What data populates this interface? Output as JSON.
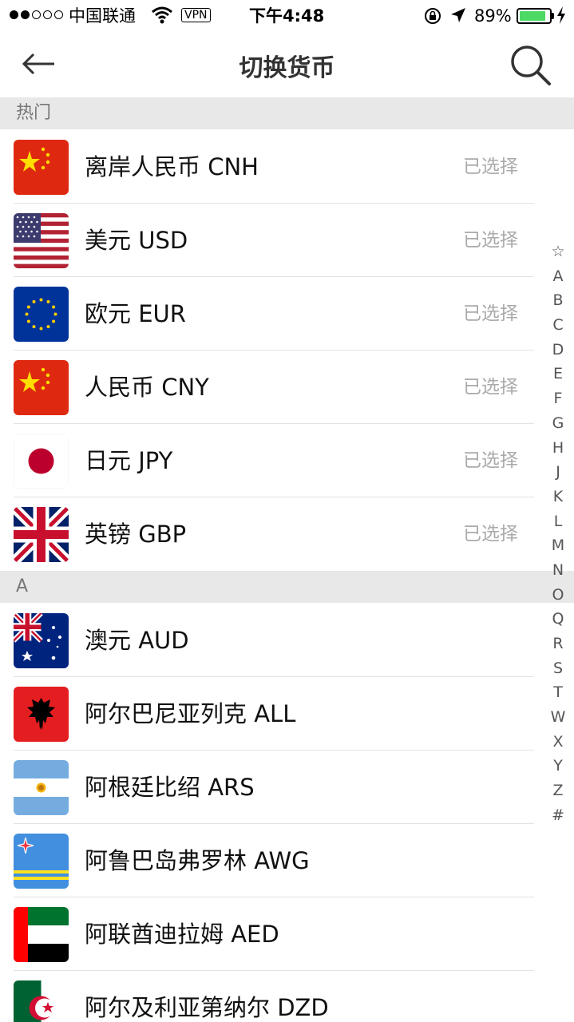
{
  "status_bar": {
    "carrier": "中国联通",
    "vpn": "VPN",
    "time": "下午4:48",
    "battery": "89%",
    "battery_level": 0.89
  },
  "nav": {
    "title": "切换货币",
    "back_icon": "arrow-left-icon",
    "search_icon": "search-icon"
  },
  "sections": [
    {
      "header": "热门",
      "items": [
        {
          "name": "离岸人民币 CNH",
          "status": "已选择",
          "flag": "china-flag-icon"
        },
        {
          "name": "美元 USD",
          "status": "已选择",
          "flag": "usa-flag-icon"
        },
        {
          "name": "欧元 EUR",
          "status": "已选择",
          "flag": "eu-flag-icon"
        },
        {
          "name": "人民币 CNY",
          "status": "已选择",
          "flag": "china-flag-icon"
        },
        {
          "name": "日元 JPY",
          "status": "已选择",
          "flag": "japan-flag-icon"
        },
        {
          "name": "英镑 GBP",
          "status": "已选择",
          "flag": "uk-flag-icon"
        }
      ]
    },
    {
      "header": "A",
      "items": [
        {
          "name": "澳元 AUD",
          "flag": "australia-flag-icon"
        },
        {
          "name": "阿尔巴尼亚列克 ALL",
          "flag": "albania-flag-icon"
        },
        {
          "name": "阿根廷比绍 ARS",
          "flag": "argentina-flag-icon"
        },
        {
          "name": "阿鲁巴岛弗罗林 AWG",
          "flag": "aruba-flag-icon"
        },
        {
          "name": "阿联酋迪拉姆 AED",
          "flag": "uae-flag-icon"
        },
        {
          "name": "阿尔及利亚第纳尔 DZD",
          "flag": "algeria-flag-icon"
        }
      ]
    }
  ],
  "index_bar": [
    "☆",
    "A",
    "B",
    "C",
    "D",
    "E",
    "F",
    "G",
    "H",
    "J",
    "K",
    "L",
    "M",
    "N",
    "O",
    "Q",
    "R",
    "S",
    "T",
    "W",
    "X",
    "Y",
    "Z",
    "#"
  ],
  "colors": {
    "section_bg": "#e8e8e8",
    "selected_text": "#aaaaaa",
    "battery": "#4cd964"
  }
}
